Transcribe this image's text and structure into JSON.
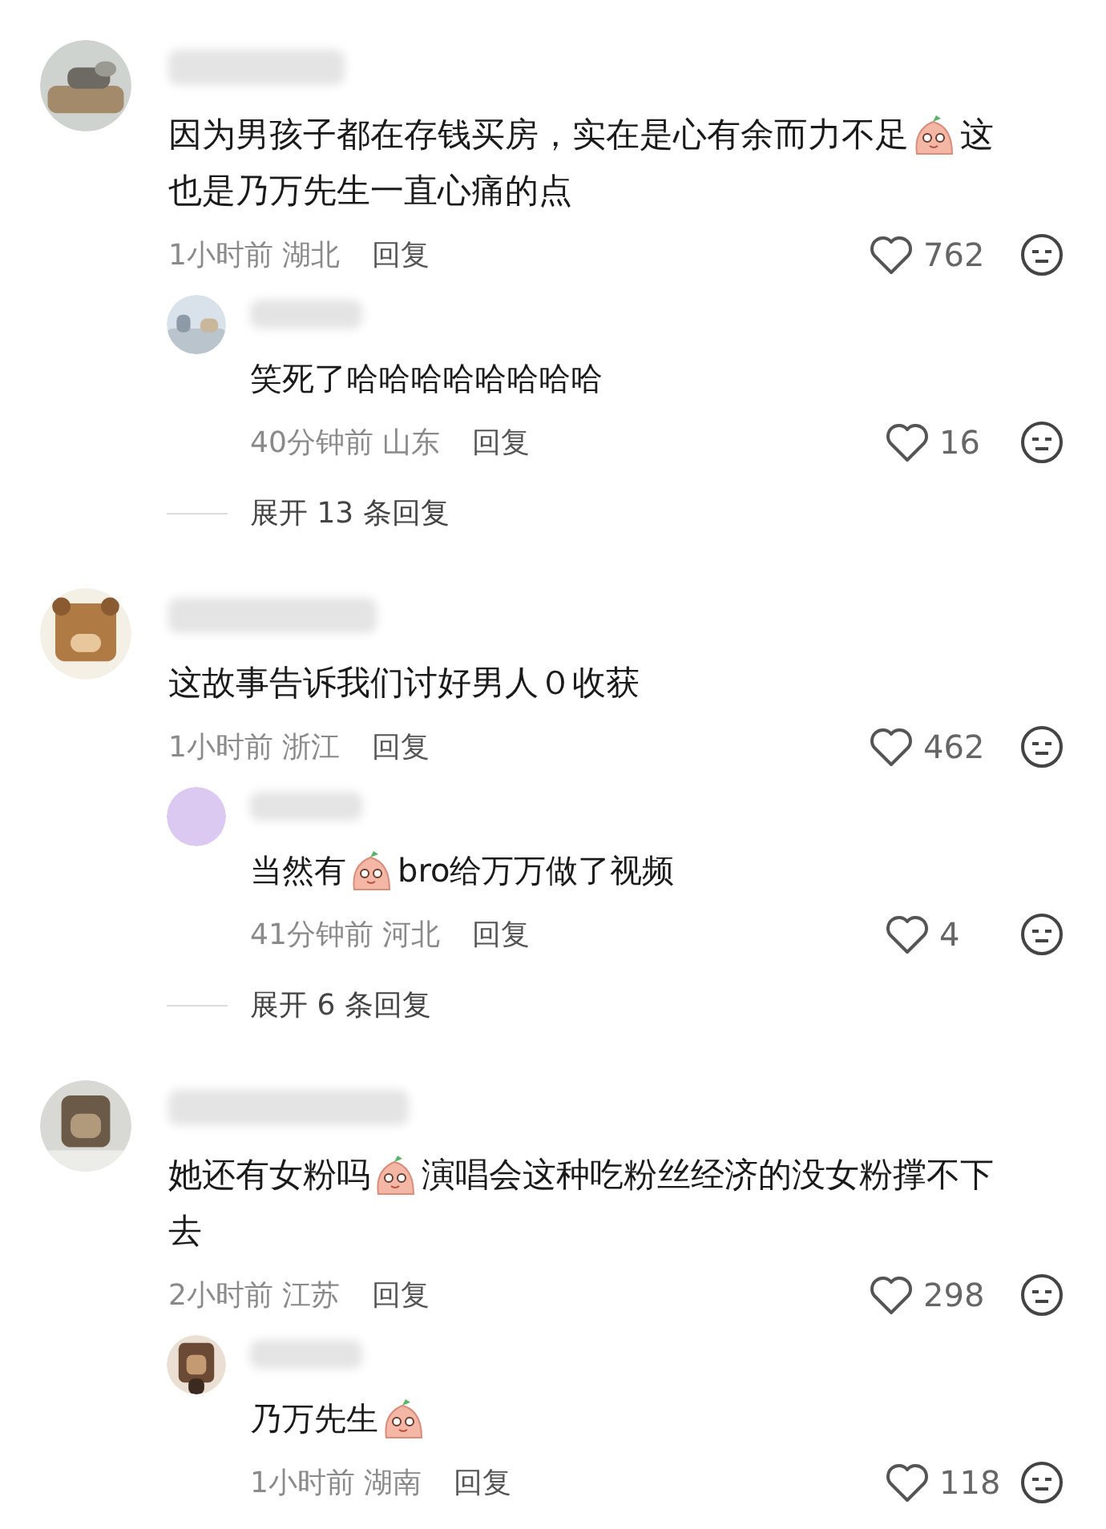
{
  "comments": [
    {
      "avatar": {
        "kind": "cat"
      },
      "content": [
        [
          {
            "kind": "text",
            "text": "因为男孩子都在存钱买房，实在是心有余而力不足"
          },
          {
            "kind": "emoji"
          },
          {
            "kind": "text",
            "text": "这"
          }
        ],
        [
          {
            "kind": "text",
            "text": "也是乃万先生一直心痛的点"
          }
        ]
      ],
      "time": "1小时前",
      "location": "湖北",
      "reply_label": "回复",
      "likes": "762",
      "liked": false,
      "replies": [
        {
          "avatar": {
            "kind": "street"
          },
          "content": [
            [
              {
                "kind": "text",
                "text": "笑死了哈哈哈哈哈哈哈哈"
              }
            ]
          ],
          "time": "40分钟前",
          "location": "山东",
          "reply_label": "回复",
          "likes": "16",
          "liked": false
        }
      ],
      "expand": "展开 13 条回复"
    },
    {
      "avatar": {
        "kind": "bear"
      },
      "content": [
        [
          {
            "kind": "text",
            "text": "这故事告诉我们讨好男人０收获"
          }
        ]
      ],
      "time": "1小时前",
      "location": "浙江",
      "reply_label": "回复",
      "likes": "462",
      "liked": false,
      "replies": [
        {
          "avatar": {
            "kind": "plain"
          },
          "content": [
            [
              {
                "kind": "text",
                "text": "当然有"
              },
              {
                "kind": "emoji"
              },
              {
                "kind": "text",
                "text": "bro给万万做了视频"
              }
            ]
          ],
          "time": "41分钟前",
          "location": "河北",
          "reply_label": "回复",
          "likes": "4",
          "liked": false
        }
      ],
      "expand": "展开 6 条回复"
    },
    {
      "avatar": {
        "kind": "monkey"
      },
      "content": [
        [
          {
            "kind": "text",
            "text": "她还有女粉吗"
          },
          {
            "kind": "emoji"
          },
          {
            "kind": "text",
            "text": "演唱会这种吃粉丝经济的没女粉撑不下"
          }
        ],
        [
          {
            "kind": "text",
            "text": "去"
          }
        ]
      ],
      "time": "2小时前",
      "location": "江苏",
      "reply_label": "回复",
      "likes": "298",
      "liked": false,
      "replies": [
        {
          "avatar": {
            "kind": "dog"
          },
          "content": [
            [
              {
                "kind": "text",
                "text": "乃万先生"
              },
              {
                "kind": "emoji"
              }
            ]
          ],
          "time": "1小时前",
          "location": "湖南",
          "reply_label": "回复",
          "likes": "118",
          "liked": false
        }
      ]
    }
  ]
}
